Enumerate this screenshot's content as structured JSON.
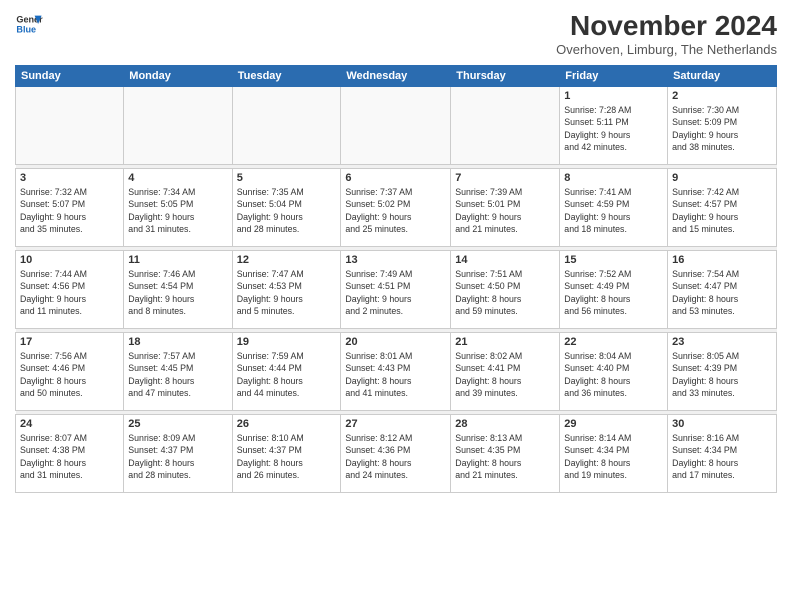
{
  "logo": {
    "line1": "General",
    "line2": "Blue"
  },
  "title": "November 2024",
  "subtitle": "Overhoven, Limburg, The Netherlands",
  "weekdays": [
    "Sunday",
    "Monday",
    "Tuesday",
    "Wednesday",
    "Thursday",
    "Friday",
    "Saturday"
  ],
  "weeks": [
    [
      {
        "day": "",
        "info": ""
      },
      {
        "day": "",
        "info": ""
      },
      {
        "day": "",
        "info": ""
      },
      {
        "day": "",
        "info": ""
      },
      {
        "day": "",
        "info": ""
      },
      {
        "day": "1",
        "info": "Sunrise: 7:28 AM\nSunset: 5:11 PM\nDaylight: 9 hours\nand 42 minutes."
      },
      {
        "day": "2",
        "info": "Sunrise: 7:30 AM\nSunset: 5:09 PM\nDaylight: 9 hours\nand 38 minutes."
      }
    ],
    [
      {
        "day": "3",
        "info": "Sunrise: 7:32 AM\nSunset: 5:07 PM\nDaylight: 9 hours\nand 35 minutes."
      },
      {
        "day": "4",
        "info": "Sunrise: 7:34 AM\nSunset: 5:05 PM\nDaylight: 9 hours\nand 31 minutes."
      },
      {
        "day": "5",
        "info": "Sunrise: 7:35 AM\nSunset: 5:04 PM\nDaylight: 9 hours\nand 28 minutes."
      },
      {
        "day": "6",
        "info": "Sunrise: 7:37 AM\nSunset: 5:02 PM\nDaylight: 9 hours\nand 25 minutes."
      },
      {
        "day": "7",
        "info": "Sunrise: 7:39 AM\nSunset: 5:01 PM\nDaylight: 9 hours\nand 21 minutes."
      },
      {
        "day": "8",
        "info": "Sunrise: 7:41 AM\nSunset: 4:59 PM\nDaylight: 9 hours\nand 18 minutes."
      },
      {
        "day": "9",
        "info": "Sunrise: 7:42 AM\nSunset: 4:57 PM\nDaylight: 9 hours\nand 15 minutes."
      }
    ],
    [
      {
        "day": "10",
        "info": "Sunrise: 7:44 AM\nSunset: 4:56 PM\nDaylight: 9 hours\nand 11 minutes."
      },
      {
        "day": "11",
        "info": "Sunrise: 7:46 AM\nSunset: 4:54 PM\nDaylight: 9 hours\nand 8 minutes."
      },
      {
        "day": "12",
        "info": "Sunrise: 7:47 AM\nSunset: 4:53 PM\nDaylight: 9 hours\nand 5 minutes."
      },
      {
        "day": "13",
        "info": "Sunrise: 7:49 AM\nSunset: 4:51 PM\nDaylight: 9 hours\nand 2 minutes."
      },
      {
        "day": "14",
        "info": "Sunrise: 7:51 AM\nSunset: 4:50 PM\nDaylight: 8 hours\nand 59 minutes."
      },
      {
        "day": "15",
        "info": "Sunrise: 7:52 AM\nSunset: 4:49 PM\nDaylight: 8 hours\nand 56 minutes."
      },
      {
        "day": "16",
        "info": "Sunrise: 7:54 AM\nSunset: 4:47 PM\nDaylight: 8 hours\nand 53 minutes."
      }
    ],
    [
      {
        "day": "17",
        "info": "Sunrise: 7:56 AM\nSunset: 4:46 PM\nDaylight: 8 hours\nand 50 minutes."
      },
      {
        "day": "18",
        "info": "Sunrise: 7:57 AM\nSunset: 4:45 PM\nDaylight: 8 hours\nand 47 minutes."
      },
      {
        "day": "19",
        "info": "Sunrise: 7:59 AM\nSunset: 4:44 PM\nDaylight: 8 hours\nand 44 minutes."
      },
      {
        "day": "20",
        "info": "Sunrise: 8:01 AM\nSunset: 4:43 PM\nDaylight: 8 hours\nand 41 minutes."
      },
      {
        "day": "21",
        "info": "Sunrise: 8:02 AM\nSunset: 4:41 PM\nDaylight: 8 hours\nand 39 minutes."
      },
      {
        "day": "22",
        "info": "Sunrise: 8:04 AM\nSunset: 4:40 PM\nDaylight: 8 hours\nand 36 minutes."
      },
      {
        "day": "23",
        "info": "Sunrise: 8:05 AM\nSunset: 4:39 PM\nDaylight: 8 hours\nand 33 minutes."
      }
    ],
    [
      {
        "day": "24",
        "info": "Sunrise: 8:07 AM\nSunset: 4:38 PM\nDaylight: 8 hours\nand 31 minutes."
      },
      {
        "day": "25",
        "info": "Sunrise: 8:09 AM\nSunset: 4:37 PM\nDaylight: 8 hours\nand 28 minutes."
      },
      {
        "day": "26",
        "info": "Sunrise: 8:10 AM\nSunset: 4:37 PM\nDaylight: 8 hours\nand 26 minutes."
      },
      {
        "day": "27",
        "info": "Sunrise: 8:12 AM\nSunset: 4:36 PM\nDaylight: 8 hours\nand 24 minutes."
      },
      {
        "day": "28",
        "info": "Sunrise: 8:13 AM\nSunset: 4:35 PM\nDaylight: 8 hours\nand 21 minutes."
      },
      {
        "day": "29",
        "info": "Sunrise: 8:14 AM\nSunset: 4:34 PM\nDaylight: 8 hours\nand 19 minutes."
      },
      {
        "day": "30",
        "info": "Sunrise: 8:16 AM\nSunset: 4:34 PM\nDaylight: 8 hours\nand 17 minutes."
      }
    ]
  ]
}
